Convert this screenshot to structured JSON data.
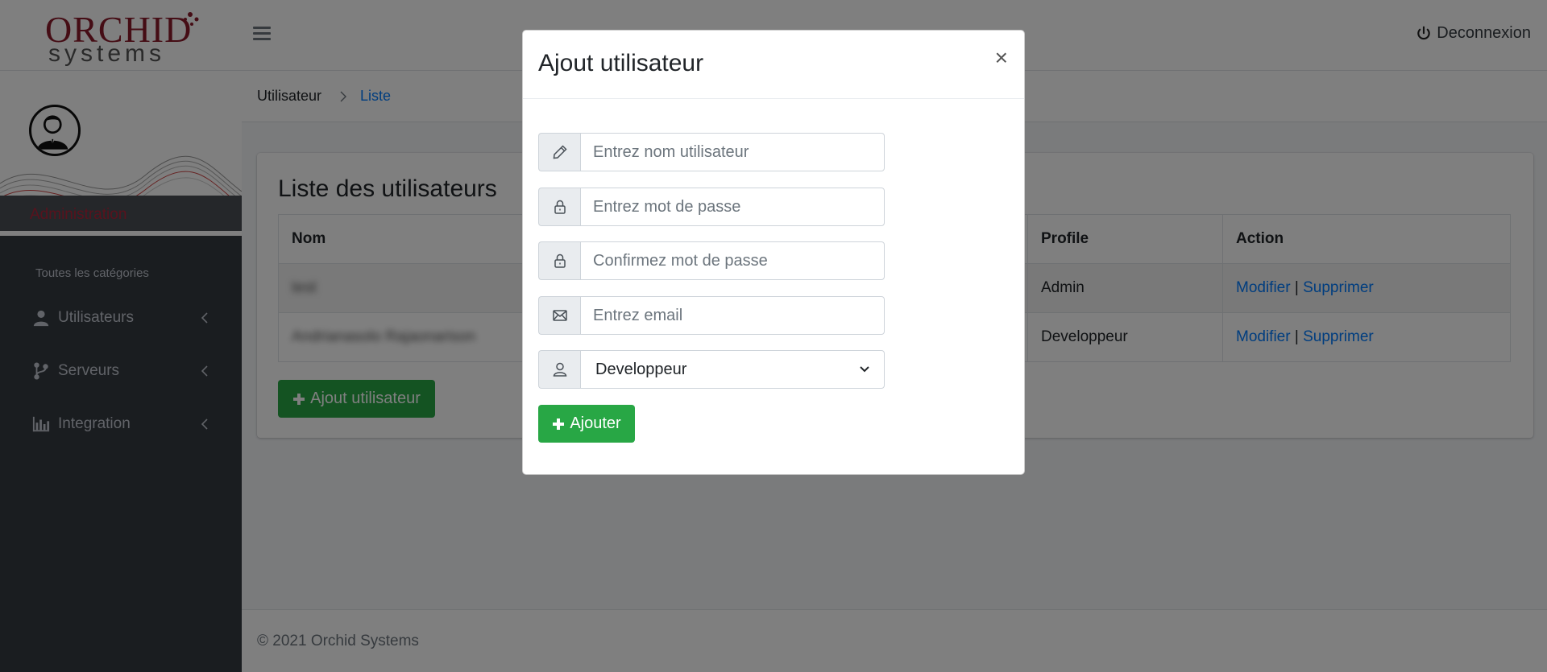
{
  "header": {
    "logo_top": "ORCHID",
    "logo_bottom": "systems",
    "logout_label": "Deconnexion"
  },
  "sidebar": {
    "role_label": "Administration",
    "category_header": "Toutes les catégories",
    "items": [
      {
        "label": "Utilisateurs",
        "icon": "user-icon"
      },
      {
        "label": "Serveurs",
        "icon": "code-branch-icon"
      },
      {
        "label": "Integration",
        "icon": "bar-chart-icon"
      }
    ]
  },
  "breadcrumb": {
    "home": "Utilisateur",
    "current": "Liste"
  },
  "card": {
    "title": "Liste des utilisateurs",
    "table": {
      "headers": [
        "Nom",
        "Profile",
        "Action"
      ],
      "rows": [
        {
          "name": "test",
          "profile": "Admin",
          "edit": "Modifier",
          "sep": "|",
          "delete": "Supprimer"
        },
        {
          "name": "Andrianasolo Rajaonarison",
          "profile": "Developpeur",
          "edit": "Modifier",
          "sep": "|",
          "delete": "Supprimer"
        }
      ]
    },
    "add_button_label": "Ajout utilisateur"
  },
  "footer": {
    "copyright": "© 2021 Orchid Systems"
  },
  "modal": {
    "title": "Ajout utilisateur",
    "close_label": "×",
    "fields": {
      "username_placeholder": "Entrez nom utilisateur",
      "password_placeholder": "Entrez mot de passe",
      "confirm_placeholder": "Confirmez mot de passe",
      "email_placeholder": "Entrez email",
      "profile_selected": "Developpeur"
    },
    "submit_label": "Ajouter"
  },
  "colors": {
    "accent_green": "#28a745",
    "link_blue": "#007bff",
    "brand_red": "#8b1a2b",
    "sidebar_dark": "#343a40"
  }
}
